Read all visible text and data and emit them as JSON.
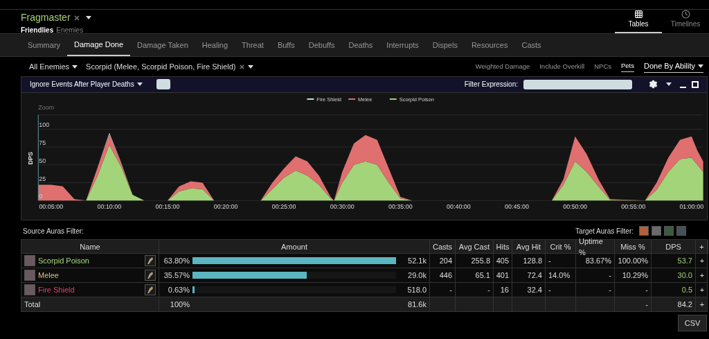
{
  "header": {
    "player": "Fragmaster",
    "filters": [
      {
        "label": "Friendlies",
        "selected": true
      },
      {
        "label": "Enemies",
        "selected": false
      }
    ],
    "views": [
      {
        "label": "Tables",
        "kind": "grid",
        "selected": true
      },
      {
        "label": "Timelines",
        "kind": "clock",
        "selected": false
      }
    ]
  },
  "nav_tabs": [
    {
      "label": "Summary",
      "selected": false
    },
    {
      "label": "Damage Done",
      "selected": true
    },
    {
      "label": "Damage Taken",
      "selected": false
    },
    {
      "label": "Healing",
      "selected": false
    },
    {
      "label": "Threat",
      "selected": false
    },
    {
      "label": "Buffs",
      "selected": false
    },
    {
      "label": "Debuffs",
      "selected": false
    },
    {
      "label": "Deaths",
      "selected": false
    },
    {
      "label": "Interrupts",
      "selected": false
    },
    {
      "label": "Dispels",
      "selected": false
    },
    {
      "label": "Resources",
      "selected": false
    },
    {
      "label": "Casts",
      "selected": false
    }
  ],
  "filter_bar": {
    "target": "All Enemies",
    "source": "Scorpid (Melee, Scorpid Poison, Fire Shield)",
    "options": [
      {
        "label": "Weighted Damage",
        "selected": false
      },
      {
        "label": "Include Overkill",
        "selected": false
      },
      {
        "label": "NPCs",
        "selected": false
      },
      {
        "label": "Pets",
        "selected": true
      }
    ],
    "mode": "Done By Ability"
  },
  "chart_panel": {
    "events_filter": "Ignore Events After Player Deaths",
    "filter_label": "Filter Expression:",
    "zoom_label": "Zoom",
    "chart_data": {
      "type": "area",
      "stacked": true,
      "grid": true,
      "legend": true,
      "ylabel": "DPS",
      "ylim": [
        0,
        120
      ],
      "xlim": [
        3.9,
        61
      ],
      "yticks": [
        0,
        25,
        50,
        75,
        100
      ],
      "xticks": [
        {
          "value": 5,
          "label": "00:05:00"
        },
        {
          "value": 10,
          "label": "00:10:00"
        },
        {
          "value": 15,
          "label": "00:15:00"
        },
        {
          "value": 20,
          "label": "00:20:00"
        },
        {
          "value": 25,
          "label": "00:25:00"
        },
        {
          "value": 30,
          "label": "00:30:00"
        },
        {
          "value": 35,
          "label": "00:35:00"
        },
        {
          "value": 40,
          "label": "00:40:00"
        },
        {
          "value": 45,
          "label": "00:45:00"
        },
        {
          "value": 50,
          "label": "00:50:00"
        },
        {
          "value": 55,
          "label": "00:55:00"
        },
        {
          "value": 60,
          "label": "01:00:00"
        }
      ],
      "x": [
        3.9,
        5,
        6,
        7,
        8,
        9,
        10,
        11,
        12,
        13,
        15,
        16,
        17,
        18,
        19,
        23,
        24,
        25,
        26,
        27,
        28,
        29,
        29.3,
        30,
        31,
        32,
        33,
        34,
        35,
        36,
        48,
        49,
        50,
        51,
        52,
        53,
        56,
        57,
        58,
        59,
        60,
        60.5,
        61
      ],
      "series": [
        {
          "name": "Scorpid Poison",
          "color": "#a3d47a",
          "values": [
            0,
            0,
            0,
            0,
            0,
            35,
            78,
            48,
            8,
            0,
            0,
            13,
            17,
            16,
            0,
            0,
            16,
            32,
            42,
            35,
            22,
            3,
            0,
            25,
            50,
            55,
            50,
            25,
            3,
            0,
            0,
            22,
            55,
            40,
            20,
            1,
            0,
            15,
            40,
            58,
            60,
            50,
            40
          ]
        },
        {
          "name": "Melee",
          "color": "#e07070",
          "values": [
            22,
            22,
            20,
            2,
            0,
            12,
            15,
            5,
            0,
            0,
            0,
            7,
            10,
            9,
            0,
            0,
            9,
            13,
            20,
            20,
            13,
            2,
            0,
            15,
            30,
            37,
            35,
            20,
            2,
            0,
            0,
            8,
            35,
            25,
            10,
            1,
            0,
            10,
            20,
            27,
            30,
            20,
            15
          ]
        },
        {
          "name": "Fire Shield",
          "color": "#bfe3ea",
          "values": [
            0,
            0,
            0,
            0,
            0,
            0,
            2,
            1,
            0,
            0,
            0,
            0,
            0,
            0,
            0,
            0,
            0,
            0,
            0,
            0,
            0,
            0,
            0,
            0,
            0,
            0,
            0,
            0,
            0,
            0,
            0,
            0,
            0,
            0,
            0,
            0,
            0,
            0,
            0,
            0,
            0,
            0,
            0
          ]
        }
      ]
    }
  },
  "auras": {
    "source_label": "Source Auras Filter:",
    "target_label": "Target Auras Filter:",
    "target_icons": [
      {
        "color": "#b0603a"
      },
      {
        "color": "#6a6a6a"
      },
      {
        "color": "#3c5a40"
      },
      {
        "color": "#44505a"
      }
    ]
  },
  "table": {
    "columns": [
      "Name",
      "Amount",
      "Casts",
      "Avg Cast",
      "Hits",
      "Avg Hit",
      "Crit %",
      "Uptime %",
      "Miss %",
      "DPS",
      "+"
    ],
    "rows": [
      {
        "name": "Scorpid Poison",
        "kind": "nature",
        "percent": "63.80%",
        "level": 1.0,
        "amount": "52.1k",
        "stats": [
          "204",
          "255.8",
          "405",
          "128.8",
          "-",
          "83.67%",
          "100.00%"
        ],
        "dps": "53.7",
        "plus": "+"
      },
      {
        "name": "Melee",
        "kind": "physical",
        "percent": "35.57%",
        "level": 0.56,
        "amount": "29.0k",
        "stats": [
          "446",
          "65.1",
          "401",
          "72.4",
          "14.0%",
          "-",
          "10.29%"
        ],
        "dps": "30.0",
        "plus": "+"
      },
      {
        "name": "Fire Shield",
        "kind": "fire",
        "percent": "0.63%",
        "level": 0.01,
        "amount": "518.0",
        "stats": [
          "-",
          "-",
          "16",
          "32.4",
          "-",
          "-",
          "-"
        ],
        "dps": "0.5",
        "plus": "+"
      }
    ],
    "total": {
      "label": "Total",
      "percent": "100%",
      "amount": "81.6k",
      "miss": "-",
      "dps": "84.2",
      "plus": "+"
    }
  },
  "csv_button": "CSV"
}
